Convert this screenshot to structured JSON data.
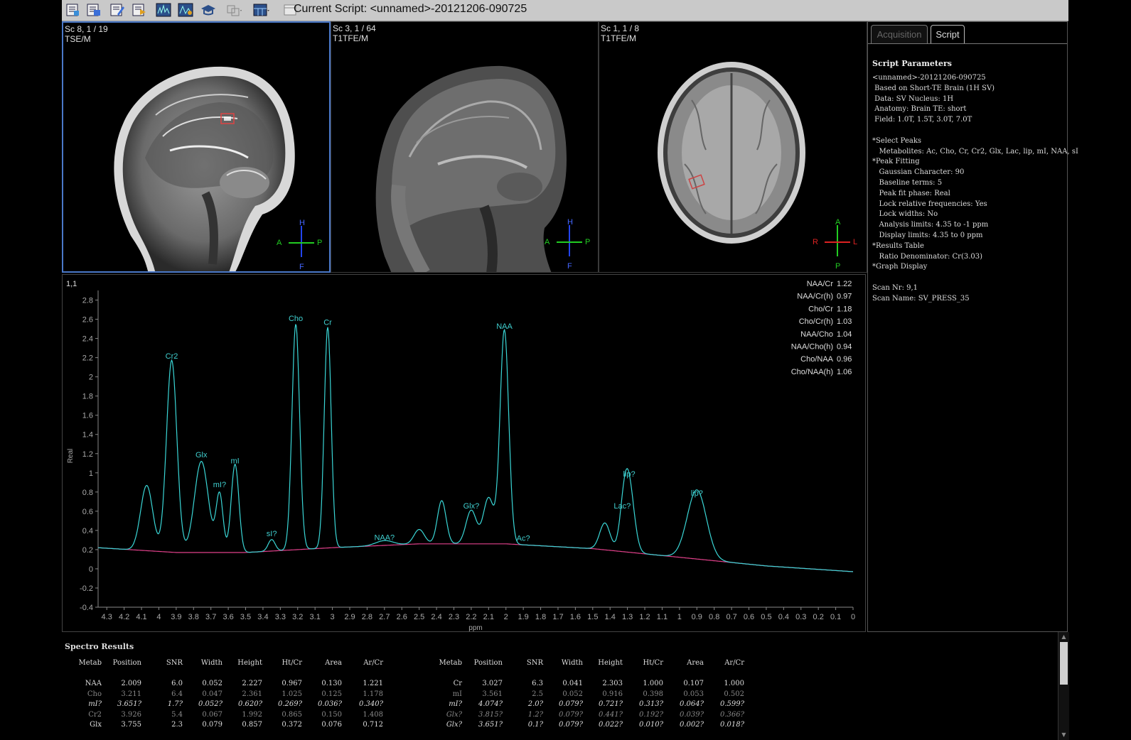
{
  "toolbar": {
    "title": "Current Script: <unnamed>-20121206-090725",
    "buttons": [
      "script-list-icon",
      "script-edit-icon",
      "script-new-icon",
      "script-run-icon",
      "spectrum-view-icon",
      "spectrum-fit-icon",
      "education-icon",
      "overlay-icon",
      "layout-icon",
      "window-icon"
    ]
  },
  "viewports": [
    {
      "line1": "Sc 8, 1 / 19",
      "line2": "TSE/M",
      "orient": {
        "top": "H",
        "bottom": "F",
        "left": "A",
        "right": "P"
      }
    },
    {
      "line1": "Sc 3, 1 / 64",
      "line2": "T1TFE/M",
      "orient": {
        "top": "H",
        "bottom": "F",
        "left": "A",
        "right": "P"
      }
    },
    {
      "line1": "Sc 1, 1 / 8",
      "line2": "T1TFE/M",
      "orient": {
        "top": "A",
        "bottom": "P",
        "left": "R",
        "right": "L"
      }
    }
  ],
  "tabs": {
    "acquisition": "Acquisition",
    "script": "Script"
  },
  "script_params": {
    "title": "Script Parameters",
    "lines": [
      "<unnamed>-20121206-090725",
      " Based on Short-TE Brain (1H SV)",
      " Data: SV  Nucleus: 1H",
      " Anatomy: Brain  TE: short",
      " Field: 1.0T, 1.5T, 3.0T, 7.0T",
      "",
      "*Select Peaks",
      "   Metabolites: Ac, Cho, Cr, Cr2, Glx, Lac, lip, mI, NAA, sI",
      "*Peak Fitting",
      "   Gaussian Character: 90",
      "   Baseline terms: 5",
      "   Peak fit phase: Real",
      "   Lock relative frequencies: Yes",
      "   Lock widths: No",
      "   Analysis limits: 4.35 to -1 ppm",
      "   Display limits: 4.35 to 0 ppm",
      "*Results Table",
      "   Ratio Denominator: Cr(3.03)",
      "*Graph Display",
      "",
      "Scan Nr: 9,1",
      "Scan Name: SV_PRESS_35"
    ]
  },
  "spectrum": {
    "corner_label": "1,1",
    "ratios": [
      {
        "name": "NAA/Cr",
        "value": "1.22"
      },
      {
        "name": "NAA/Cr(h)",
        "value": "0.97"
      },
      {
        "name": "Cho/Cr",
        "value": "1.18"
      },
      {
        "name": "Cho/Cr(h)",
        "value": "1.03"
      },
      {
        "name": "NAA/Cho",
        "value": "1.04"
      },
      {
        "name": "NAA/Cho(h)",
        "value": "0.94"
      },
      {
        "name": "Cho/NAA",
        "value": "0.96"
      },
      {
        "name": "Cho/NAA(h)",
        "value": "1.06"
      }
    ]
  },
  "chart_data": {
    "type": "line",
    "xlabel": "ppm",
    "ylabel": "Real",
    "xlim": [
      4.35,
      0
    ],
    "ylim": [
      -0.4,
      2.9
    ],
    "x_ticks": [
      "4.3",
      "4.2",
      "4.1",
      "4",
      "3.9",
      "3.8",
      "3.7",
      "3.6",
      "3.5",
      "3.4",
      "3.3",
      "3.2",
      "3.1",
      "3",
      "2.9",
      "2.8",
      "2.7",
      "2.6",
      "2.5",
      "2.4",
      "2.3",
      "2.2",
      "2.1",
      "2",
      "1.9",
      "1.8",
      "1.7",
      "1.6",
      "1.5",
      "1.4",
      "1.3",
      "1.2",
      "1.1",
      "1",
      "0.9",
      "0.8",
      "0.7",
      "0.6",
      "0.5",
      "0.4",
      "0.3",
      "0.2",
      "0.1",
      "0"
    ],
    "y_ticks": [
      "2.8",
      "2.6",
      "2.4",
      "2.2",
      "2",
      "1.8",
      "1.6",
      "1.4",
      "1.2",
      "1",
      "0.8",
      "0.6",
      "0.4",
      "0.2",
      "0",
      "-0.2",
      "-0.4"
    ],
    "baseline": {
      "x": [
        4.35,
        3.9,
        3.5,
        3.0,
        2.5,
        2.0,
        1.5,
        1.0,
        0.5,
        0.0
      ],
      "y": [
        0.22,
        0.17,
        0.17,
        0.22,
        0.26,
        0.26,
        0.21,
        0.12,
        0.03,
        -0.03
      ]
    },
    "peaks": [
      {
        "ppm": 4.07,
        "height": 0.68,
        "width": 0.035
      },
      {
        "ppm": 3.926,
        "height": 2.0,
        "width": 0.03
      },
      {
        "ppm": 3.755,
        "height": 0.95,
        "width": 0.04
      },
      {
        "ppm": 3.65,
        "height": 0.6,
        "width": 0.02
      },
      {
        "ppm": 3.561,
        "height": 0.92,
        "width": 0.022
      },
      {
        "ppm": 3.35,
        "height": 0.12,
        "width": 0.02
      },
      {
        "ppm": 3.211,
        "height": 2.35,
        "width": 0.022
      },
      {
        "ppm": 3.027,
        "height": 2.3,
        "width": 0.02
      },
      {
        "ppm": 2.7,
        "height": 0.05,
        "width": 0.05
      },
      {
        "ppm": 2.5,
        "height": 0.15,
        "width": 0.03
      },
      {
        "ppm": 2.37,
        "height": 0.45,
        "width": 0.025
      },
      {
        "ppm": 2.2,
        "height": 0.35,
        "width": 0.03
      },
      {
        "ppm": 2.1,
        "height": 0.48,
        "width": 0.03
      },
      {
        "ppm": 2.009,
        "height": 2.227,
        "width": 0.025
      },
      {
        "ppm": 1.43,
        "height": 0.28,
        "width": 0.03
      },
      {
        "ppm": 1.32,
        "height": 0.35,
        "width": 0.025
      },
      {
        "ppm": 1.29,
        "height": 0.65,
        "width": 0.03
      },
      {
        "ppm": 0.9,
        "height": 0.72,
        "width": 0.055
      }
    ],
    "annotations": [
      {
        "text": "Cr2",
        "ppm": 3.926,
        "y": 2.19
      },
      {
        "text": "Glx",
        "ppm": 3.755,
        "y": 1.16
      },
      {
        "text": "mI?",
        "ppm": 3.65,
        "y": 0.85
      },
      {
        "text": "mI",
        "ppm": 3.561,
        "y": 1.1
      },
      {
        "text": "sI?",
        "ppm": 3.35,
        "y": 0.34
      },
      {
        "text": "Cho",
        "ppm": 3.211,
        "y": 2.58
      },
      {
        "text": "Cr",
        "ppm": 3.027,
        "y": 2.54
      },
      {
        "text": "NAA?",
        "ppm": 2.7,
        "y": 0.3
      },
      {
        "text": "Glx?",
        "ppm": 2.2,
        "y": 0.63
      },
      {
        "text": "NAA",
        "ppm": 2.009,
        "y": 2.5
      },
      {
        "text": "Ac?",
        "ppm": 1.9,
        "y": 0.29
      },
      {
        "text": "Lac?",
        "ppm": 1.33,
        "y": 0.63
      },
      {
        "text": "lip?",
        "ppm": 1.29,
        "y": 0.96
      },
      {
        "text": "lip?",
        "ppm": 0.9,
        "y": 0.76
      }
    ]
  },
  "results": {
    "title": "Spectro Results",
    "headers": [
      "Metab",
      "Position",
      "SNR",
      "Width",
      "Height",
      "Ht/Cr",
      "Area",
      "Ar/Cr"
    ],
    "left_rows": [
      {
        "style": "normal",
        "cells": [
          "NAA",
          "2.009",
          "6.0",
          "0.052",
          "2.227",
          "0.967",
          "0.130",
          "1.221"
        ]
      },
      {
        "style": "dim",
        "cells": [
          "Cho",
          "3.211",
          "6.4",
          "0.047",
          "2.361",
          "1.025",
          "0.125",
          "1.178"
        ]
      },
      {
        "style": "italic",
        "cells": [
          "mI?",
          "3.651?",
          "1.7?",
          "0.052?",
          "0.620?",
          "0.269?",
          "0.036?",
          "0.340?"
        ]
      },
      {
        "style": "dim",
        "cells": [
          "Cr2",
          "3.926",
          "5.4",
          "0.067",
          "1.992",
          "0.865",
          "0.150",
          "1.408"
        ]
      },
      {
        "style": "normal",
        "cells": [
          "Glx",
          "3.755",
          "2.3",
          "0.079",
          "0.857",
          "0.372",
          "0.076",
          "0.712"
        ]
      }
    ],
    "right_rows": [
      {
        "style": "normal",
        "cells": [
          "Cr",
          "3.027",
          "6.3",
          "0.041",
          "2.303",
          "1.000",
          "0.107",
          "1.000"
        ]
      },
      {
        "style": "dim",
        "cells": [
          "mI",
          "3.561",
          "2.5",
          "0.052",
          "0.916",
          "0.398",
          "0.053",
          "0.502"
        ]
      },
      {
        "style": "italic",
        "cells": [
          "mI?",
          "4.074?",
          "2.0?",
          "0.079?",
          "0.721?",
          "0.313?",
          "0.064?",
          "0.599?"
        ]
      },
      {
        "style": "dimitalic",
        "cells": [
          "Glx?",
          "3.815?",
          "1.2?",
          "0.079?",
          "0.441?",
          "0.192?",
          "0.039?",
          "0.366?"
        ]
      },
      {
        "style": "italic",
        "cells": [
          "Glx?",
          "3.651?",
          "0.1?",
          "0.079?",
          "0.022?",
          "0.010?",
          "0.002?",
          "0.018?"
        ]
      }
    ]
  },
  "colors": {
    "spectrum": "#3ad6d6",
    "baseline": "#e0408a",
    "label": "#40d0d0",
    "accent_border": "#4a78c8"
  }
}
